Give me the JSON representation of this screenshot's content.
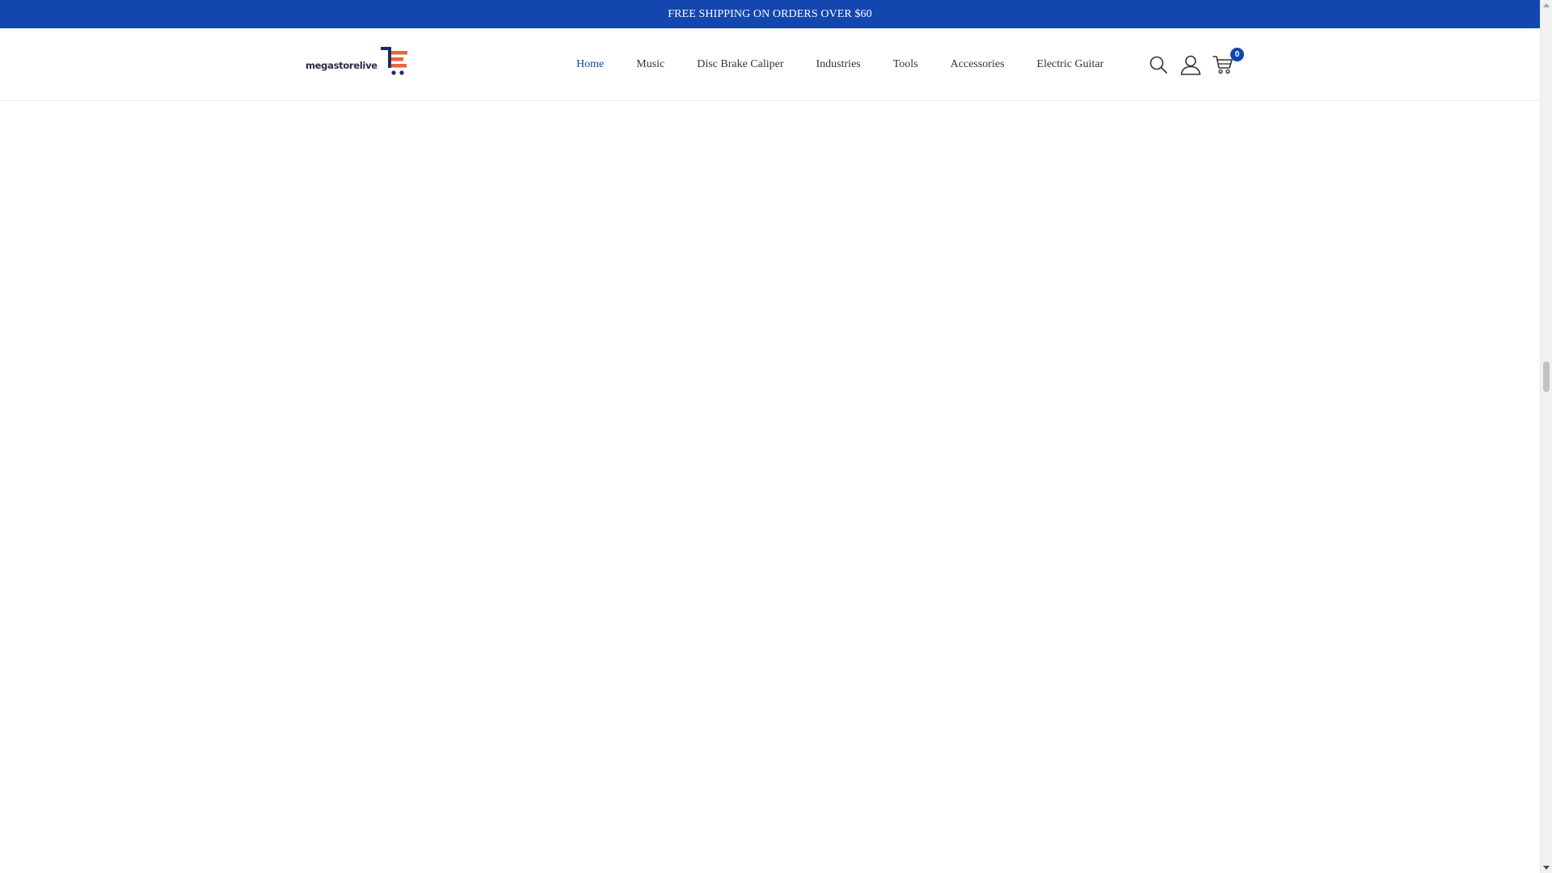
{
  "announcement": {
    "text": "FREE SHIPPING ON ORDERS OVER $60"
  },
  "brand": {
    "logo_text": "megastorelive",
    "colors": {
      "primary": "#1446af",
      "accent": "#f0623a",
      "logo_text": "#2a2a4a"
    }
  },
  "nav": {
    "items": [
      {
        "label": "Home",
        "active": true
      },
      {
        "label": "Music"
      },
      {
        "label": "Disc Brake Caliper"
      },
      {
        "label": "Industries"
      },
      {
        "label": "Tools"
      },
      {
        "label": "Accessories"
      },
      {
        "label": "Electric Guitar"
      }
    ]
  },
  "header_icons": {
    "search": "search-icon",
    "account": "user-icon",
    "cart": "cart-icon",
    "cart_count": "0"
  }
}
